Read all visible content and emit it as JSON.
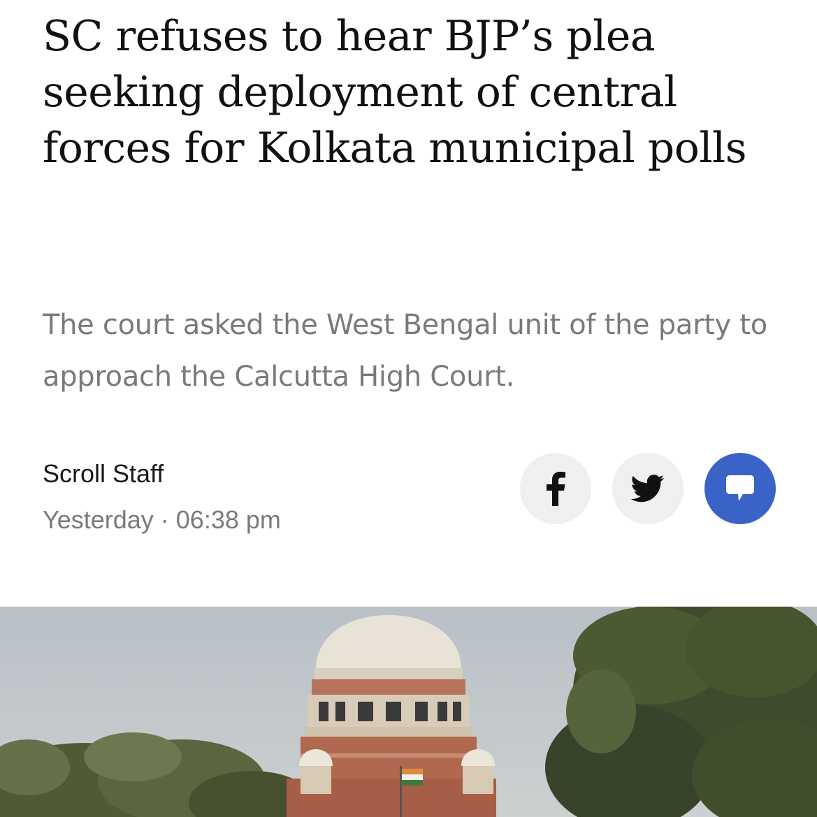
{
  "article": {
    "headline": "SC refuses to hear BJP’s plea seeking deployment of central forces for Kolkata municipal polls",
    "subhead": "The court asked the West Bengal unit of the party to approach the Calcutta High Court.",
    "author": "Scroll Staff",
    "timestamp": "Yesterday · 06:38 pm"
  },
  "share": {
    "buttons": [
      {
        "name": "facebook",
        "icon": "facebook-icon"
      },
      {
        "name": "twitter",
        "icon": "twitter-icon"
      },
      {
        "name": "comment",
        "icon": "comment-icon"
      }
    ]
  },
  "colors": {
    "headline": "#111111",
    "muted": "#7a7a7a",
    "share_bg": "#efefef",
    "comment_accent": "#3a63c7"
  },
  "hero_image": {
    "subject": "supreme-court-building-photo"
  }
}
